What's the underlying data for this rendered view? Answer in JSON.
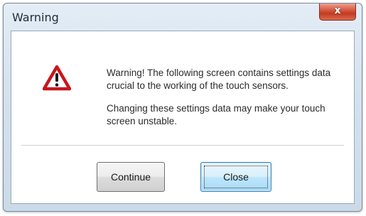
{
  "window": {
    "title": "Warning",
    "close_glyph": "x"
  },
  "message": {
    "line1": "Warning! The following screen contains settings data crucial to the working of the touch sensors.",
    "line2": "Changing these settings data may make your touch screen unstable."
  },
  "buttons": {
    "continue_label": "Continue",
    "close_label": "Close"
  },
  "icons": {
    "warning": "warning-triangle-icon"
  },
  "colors": {
    "warning_red": "#c8161d",
    "close_button_red": "#c13b22"
  }
}
